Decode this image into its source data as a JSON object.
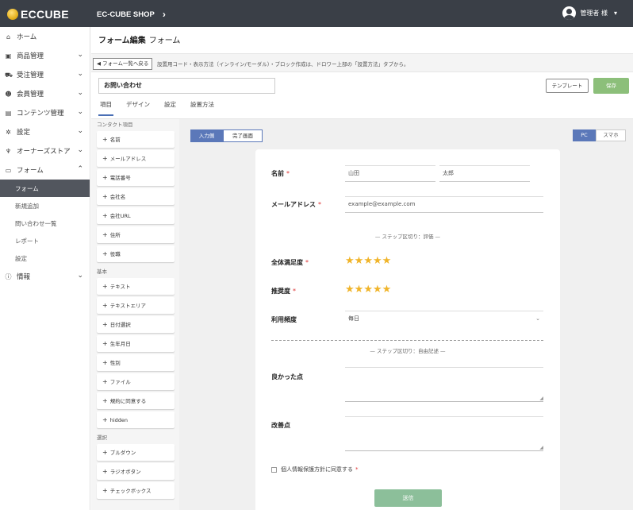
{
  "header": {
    "logo_text": "ECCUBE",
    "shop_name": "EC-CUBE SHOP",
    "user_name": "管理者 様"
  },
  "sidebar": {
    "items": [
      {
        "label": "ホーム",
        "icon": "home-icon"
      },
      {
        "label": "商品管理",
        "icon": "box-icon"
      },
      {
        "label": "受注管理",
        "icon": "cart-icon"
      },
      {
        "label": "会員管理",
        "icon": "users-icon"
      },
      {
        "label": "コンテンツ管理",
        "icon": "file-icon"
      },
      {
        "label": "設定",
        "icon": "gear-icon"
      },
      {
        "label": "オーナーズストア",
        "icon": "plug-icon"
      },
      {
        "label": "フォーム",
        "icon": "form-icon"
      }
    ],
    "form_sub": [
      "フォーム",
      "新規追加",
      "問い合わせ一覧",
      "レポート",
      "設定"
    ],
    "info": {
      "label": "情報",
      "icon": "info-icon"
    }
  },
  "page": {
    "title": "フォーム編集",
    "subtitle": "フォーム",
    "back_label": "◀ フォーム一覧へ戻る",
    "info_text": "設置用コード・表示方法（インライン/モーダル）・ブロック作成は、ドロワー上部の「設置方法」タブから。",
    "form_name": "お問い合わせ",
    "template_label": "テンプレート",
    "save_label": "保存"
  },
  "tabs": [
    "項目",
    "デザイン",
    "設定",
    "設置方法"
  ],
  "palette": {
    "contact_title": "コンタクト項目",
    "contact": [
      "名前",
      "メールアドレス",
      "電話番号",
      "会社名",
      "会社URL",
      "住所",
      "役職"
    ],
    "basic_title": "基本",
    "basic": [
      "テキスト",
      "テキストエリア",
      "日付選択",
      "生年月日",
      "性別",
      "ファイル",
      "規約に同意する",
      "hidden"
    ],
    "select_title": "選択",
    "select": [
      "プルダウン",
      "ラジオボタン",
      "チェックボックス"
    ]
  },
  "canvas": {
    "mode_input": "入力側",
    "mode_complete": "完了画面",
    "device_pc": "PC",
    "device_sp": "スマホ"
  },
  "form": {
    "name_label": "名前",
    "last_name_ph": "山田",
    "first_name_ph": "太郎",
    "email_label": "メールアドレス",
    "email_ph": "example@example.com",
    "step_sep_1": "— ステップ区切り：評価 —",
    "overall_label": "全体満足度",
    "recommend_label": "推奨度",
    "overall_stars": 5,
    "recommend_stars": 5,
    "usage_label": "利用頻度",
    "usage_value": "毎日",
    "step_sep_2": "— ステップ区切り：自由記述 —",
    "good_label": "良かった点",
    "improve_label": "改善点",
    "agree_text": "個人情報保護方針に同意する",
    "required_mark": "*",
    "submit_label": "送信"
  }
}
